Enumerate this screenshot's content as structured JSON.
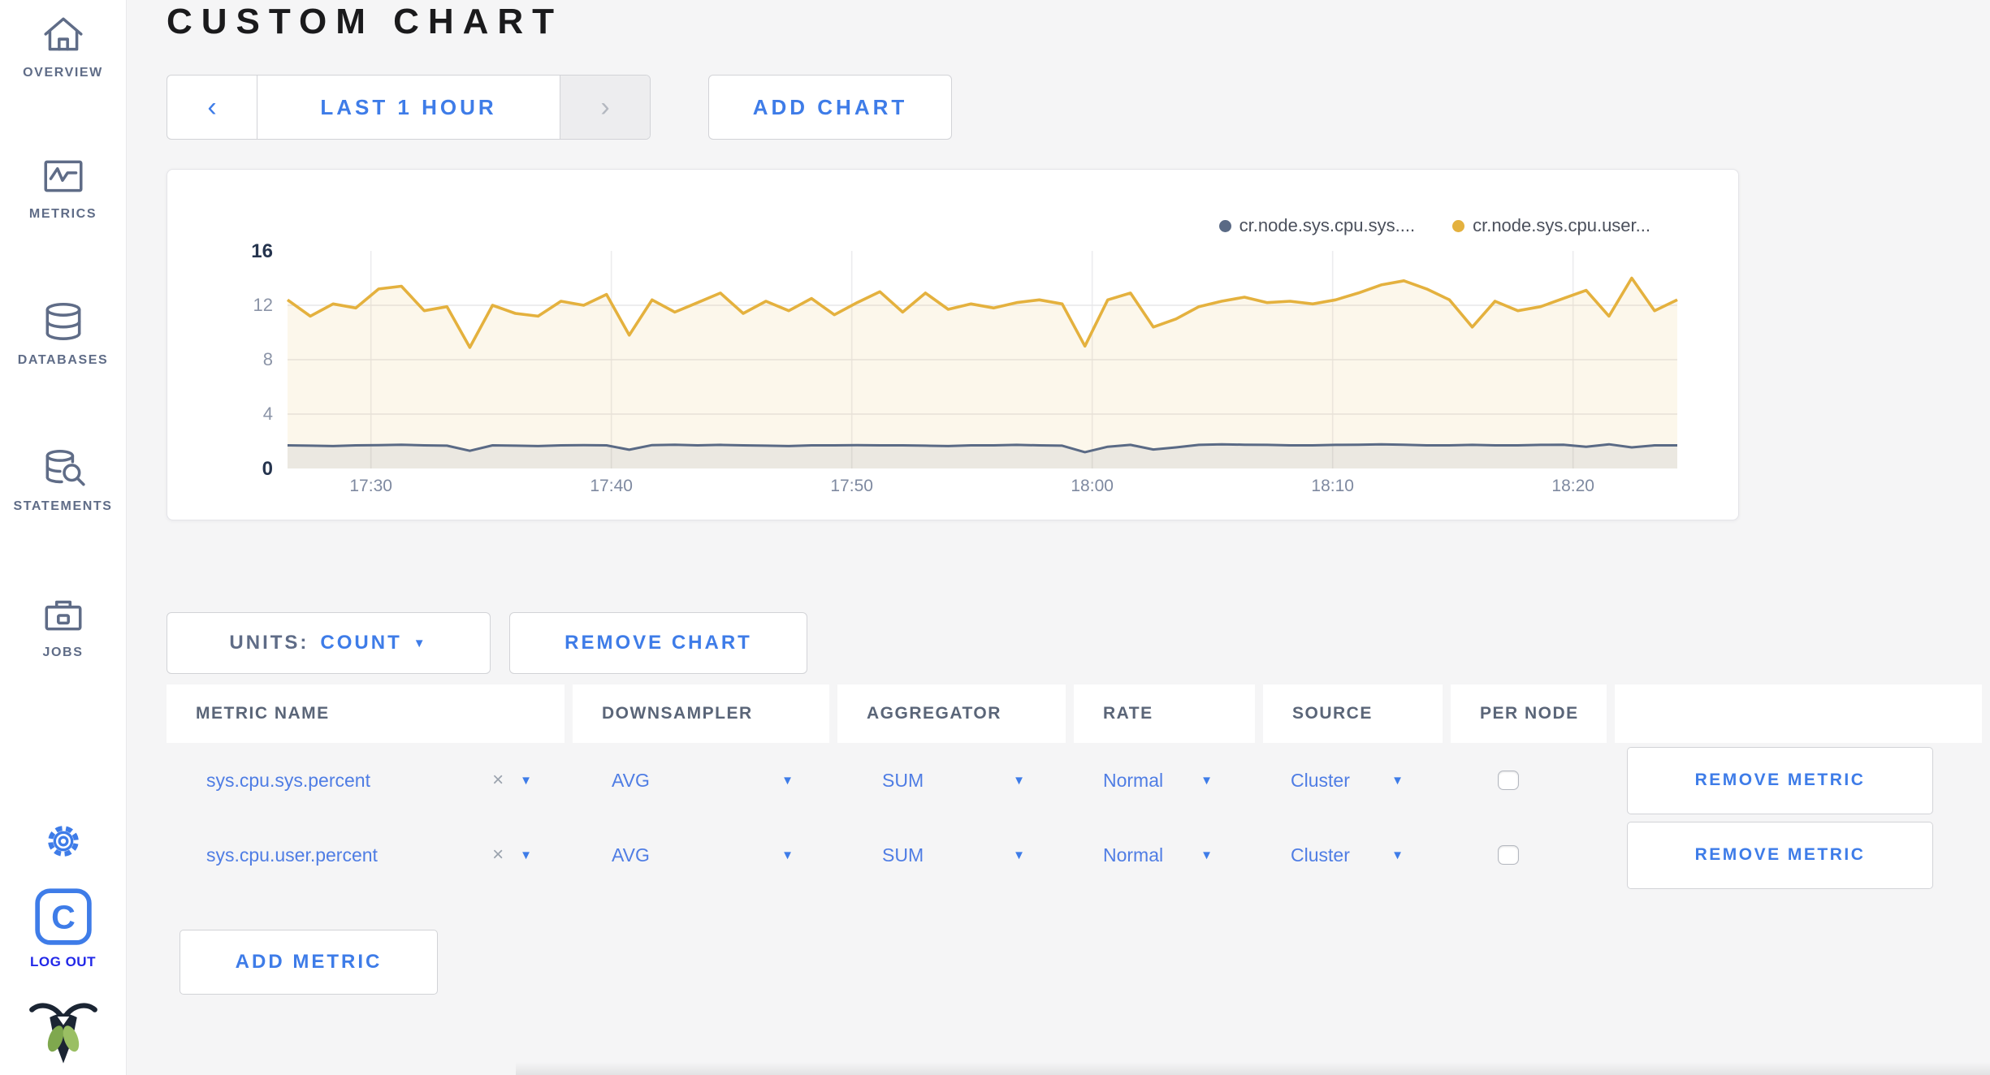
{
  "app": {
    "title": "CUSTOM CHART"
  },
  "icons": {
    "caret_down": "▼",
    "close": "×",
    "chevron_left": "‹",
    "chevron_right": "›"
  },
  "sidebar": {
    "items": [
      {
        "label": "OVERVIEW"
      },
      {
        "label": "METRICS"
      },
      {
        "label": "DATABASES"
      },
      {
        "label": "STATEMENTS"
      },
      {
        "label": "JOBS"
      }
    ],
    "logout_label": "LOG OUT"
  },
  "toolbar": {
    "time_range_label": "LAST 1 HOUR",
    "add_chart_label": "ADD CHART"
  },
  "chart_controls": {
    "units_label": "UNITS:",
    "units_value": "COUNT",
    "remove_chart_label": "REMOVE CHART",
    "add_metric_label": "ADD METRIC"
  },
  "table": {
    "columns": [
      "METRIC NAME",
      "DOWNSAMPLER",
      "AGGREGATOR",
      "RATE",
      "SOURCE",
      "PER NODE",
      ""
    ],
    "remove_metric_label": "REMOVE METRIC",
    "rows": [
      {
        "metric": "sys.cpu.sys.percent",
        "downsampler": "AVG",
        "aggregator": "SUM",
        "rate": "Normal",
        "source": "Cluster",
        "per_node_checked": false
      },
      {
        "metric": "sys.cpu.user.percent",
        "downsampler": "AVG",
        "aggregator": "SUM",
        "rate": "Normal",
        "source": "Cluster",
        "per_node_checked": false
      }
    ]
  },
  "chart_data": {
    "type": "line",
    "title": "",
    "ylim": [
      0,
      16
    ],
    "y_ticks": [
      0,
      4,
      8,
      12,
      16
    ],
    "x_ticks": [
      "17:30",
      "17:40",
      "17:50",
      "18:00",
      "18:10",
      "18:20"
    ],
    "x_tick_fractions": [
      0.06,
      0.233,
      0.406,
      0.579,
      0.752,
      0.925
    ],
    "grid": true,
    "legend_position": "top-right",
    "series": [
      {
        "name": "cr.node.sys.cpu.sys....",
        "color": "#5a6a85",
        "fill": "rgba(90,106,133,0.10)",
        "values": [
          1.7,
          1.68,
          1.65,
          1.7,
          1.72,
          1.75,
          1.7,
          1.68,
          1.3,
          1.7,
          1.68,
          1.65,
          1.7,
          1.72,
          1.7,
          1.38,
          1.72,
          1.75,
          1.7,
          1.74,
          1.7,
          1.68,
          1.65,
          1.7,
          1.7,
          1.72,
          1.7,
          1.7,
          1.68,
          1.65,
          1.7,
          1.7,
          1.74,
          1.7,
          1.68,
          1.2,
          1.6,
          1.74,
          1.4,
          1.55,
          1.74,
          1.78,
          1.75,
          1.74,
          1.7,
          1.7,
          1.74,
          1.75,
          1.78,
          1.75,
          1.7,
          1.7,
          1.74,
          1.7,
          1.7,
          1.74,
          1.75,
          1.6,
          1.78,
          1.55,
          1.7,
          1.7
        ]
      },
      {
        "name": "cr.node.sys.cpu.user...",
        "color": "#e4b13e",
        "fill": "rgba(228,177,62,0.10)",
        "values": [
          12.4,
          11.2,
          12.1,
          11.8,
          13.2,
          13.4,
          11.6,
          11.9,
          8.9,
          12.0,
          11.4,
          11.2,
          12.3,
          12.0,
          12.8,
          9.8,
          12.4,
          11.5,
          12.2,
          12.9,
          11.4,
          12.3,
          11.6,
          12.5,
          11.3,
          12.2,
          13.0,
          11.5,
          12.9,
          11.7,
          12.1,
          11.8,
          12.2,
          12.4,
          12.1,
          9.0,
          12.4,
          12.9,
          10.4,
          11.0,
          11.9,
          12.3,
          12.6,
          12.2,
          12.3,
          12.1,
          12.4,
          12.9,
          13.5,
          13.8,
          13.2,
          12.4,
          10.4,
          12.3,
          11.6,
          11.9,
          12.5,
          13.1,
          11.2,
          14.0,
          11.6,
          12.4
        ]
      }
    ]
  },
  "colors": {
    "accent": "#3e7ce8",
    "logout_blue": "#2228e8",
    "sidebar_text": "#5f6c87",
    "title_text": "#1a1a1c",
    "axis_strong": "#25344e",
    "axis_weak": "#8b94a7",
    "grid_line": "#ececee",
    "panel_bg": "#ffffff",
    "page_bg": "#f5f5f6"
  }
}
